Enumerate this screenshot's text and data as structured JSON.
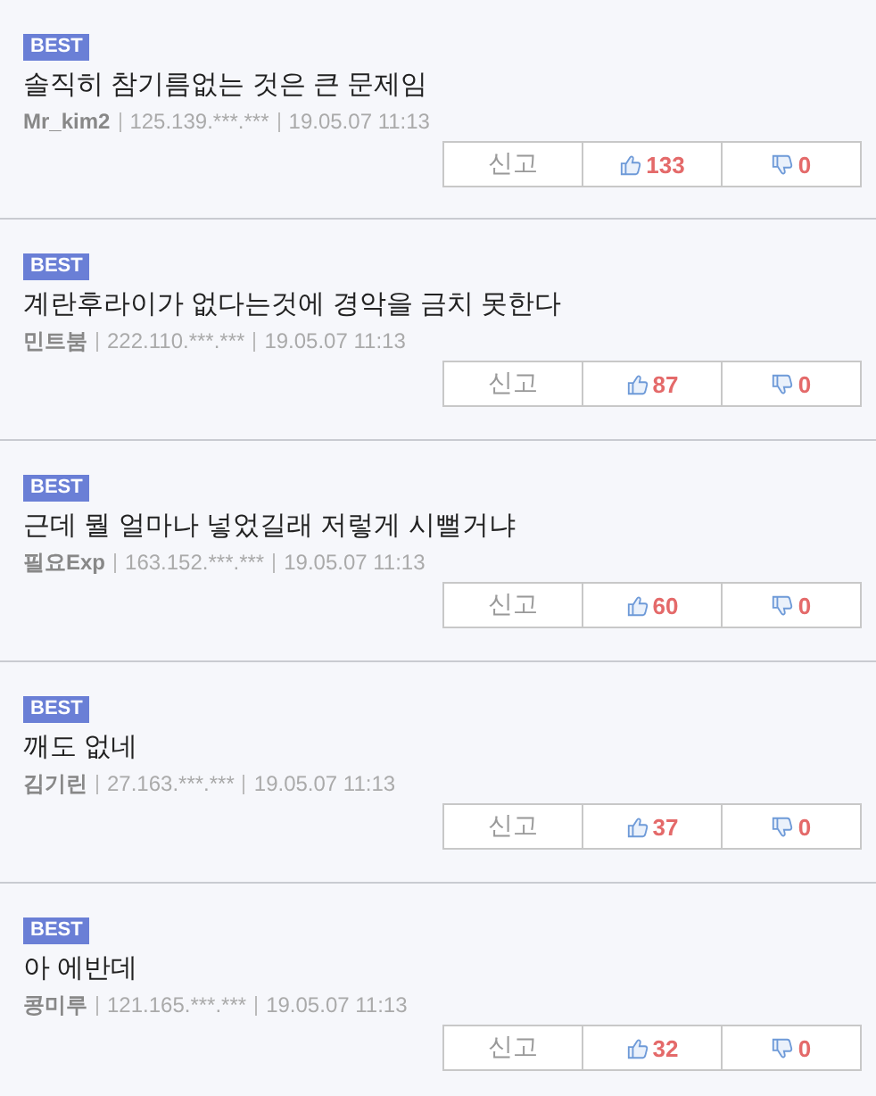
{
  "comments": [
    {
      "badge": "BEST",
      "text": "솔직히 참기름없는 것은 큰 문제임",
      "author": "Mr_kim2",
      "ip": "125.139.***.***",
      "date": "19.05.07 11:13",
      "report": "신고",
      "likes": "133",
      "dislikes": "0"
    },
    {
      "badge": "BEST",
      "text": "계란후라이가 없다는것에 경악을 금치 못한다",
      "author": "민트붐",
      "ip": "222.110.***.***",
      "date": "19.05.07 11:13",
      "report": "신고",
      "likes": "87",
      "dislikes": "0"
    },
    {
      "badge": "BEST",
      "text": "근데 뭘 얼마나 넣었길래 저렇게 시뻘거냐",
      "author": "필요Exp",
      "ip": "163.152.***.***",
      "date": "19.05.07 11:13",
      "report": "신고",
      "likes": "60",
      "dislikes": "0"
    },
    {
      "badge": "BEST",
      "text": "깨도 없네",
      "author": "김기린",
      "ip": "27.163.***.***",
      "date": "19.05.07 11:13",
      "report": "신고",
      "likes": "37",
      "dislikes": "0"
    },
    {
      "badge": "BEST",
      "text": "아 에반데",
      "author": "콩미루",
      "ip": "121.165.***.***",
      "date": "19.05.07 11:13",
      "report": "신고",
      "likes": "32",
      "dislikes": "0"
    }
  ]
}
